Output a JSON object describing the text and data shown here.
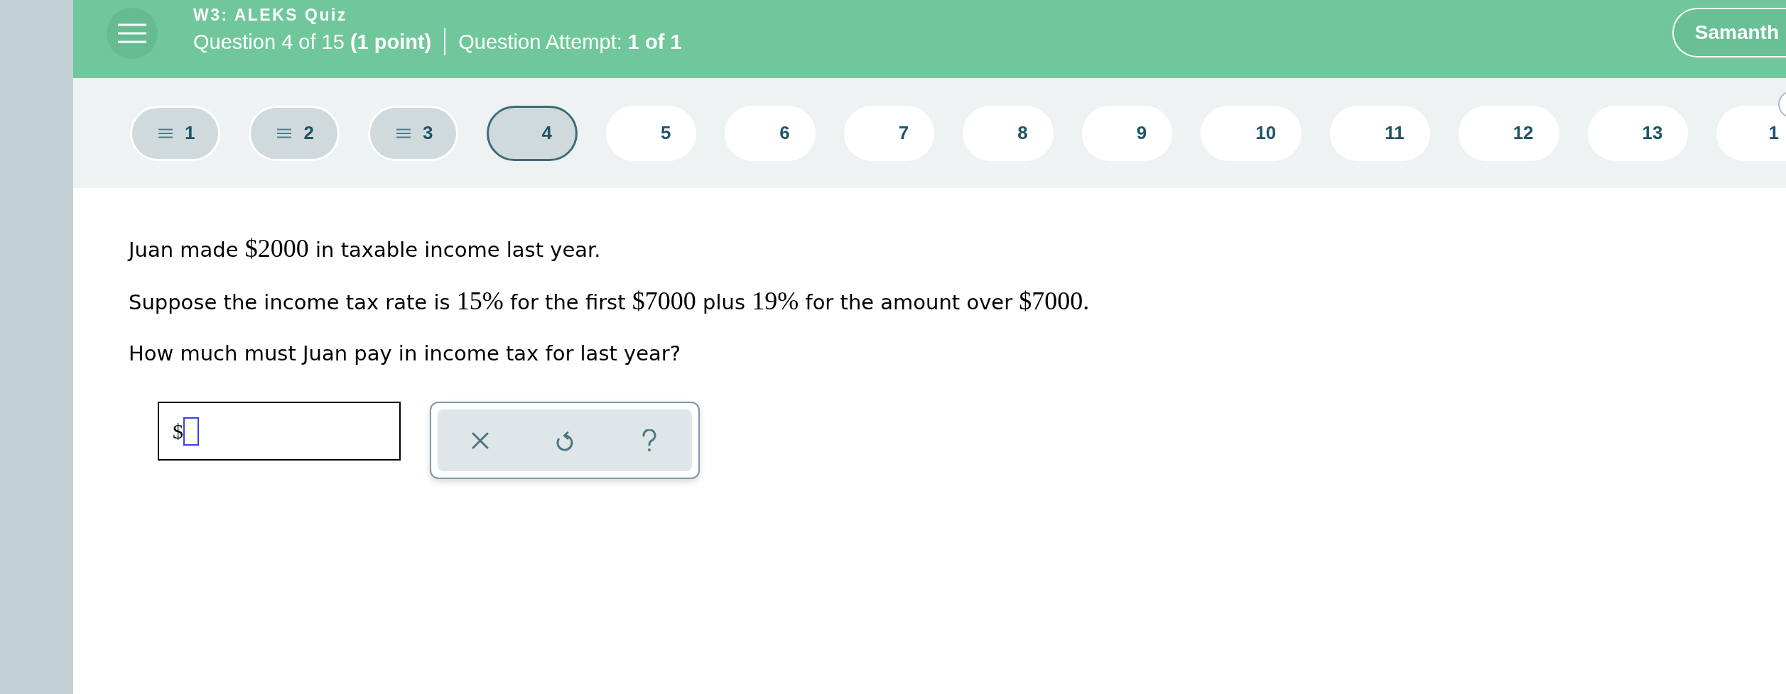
{
  "header": {
    "title": "W3: ALEKS Quiz",
    "question_info": "Question 4 of 15 **(1 point)**",
    "attempt_info": "Question Attempt: **1 of 1**",
    "user_button": "Samanth"
  },
  "question_nav": [
    {
      "label": "1",
      "answered": true,
      "selected": false
    },
    {
      "label": "2",
      "answered": true,
      "selected": false
    },
    {
      "label": "3",
      "answered": true,
      "selected": false
    },
    {
      "label": "4",
      "answered": false,
      "selected": true
    },
    {
      "label": "5",
      "answered": false,
      "selected": false
    },
    {
      "label": "6",
      "answered": false,
      "selected": false
    },
    {
      "label": "7",
      "answered": false,
      "selected": false
    },
    {
      "label": "8",
      "answered": false,
      "selected": false
    },
    {
      "label": "9",
      "answered": false,
      "selected": false
    },
    {
      "label": "10",
      "answered": false,
      "selected": false
    },
    {
      "label": "11",
      "answered": false,
      "selected": false
    },
    {
      "label": "12",
      "answered": false,
      "selected": false
    },
    {
      "label": "13",
      "answered": false,
      "selected": false
    },
    {
      "label": "1",
      "answered": false,
      "selected": false
    }
  ],
  "question": {
    "paragraphs": [
      [
        {
          "kind": "text",
          "text": "Juan made "
        },
        {
          "kind": "math",
          "text": "$2000"
        },
        {
          "kind": "text",
          "text": " in taxable income last year."
        }
      ],
      [
        {
          "kind": "text",
          "text": "Suppose the income tax rate is "
        },
        {
          "kind": "math",
          "text": "15%"
        },
        {
          "kind": "text",
          "text": " for the first "
        },
        {
          "kind": "math",
          "text": "$7000"
        },
        {
          "kind": "text",
          "text": " plus "
        },
        {
          "kind": "math",
          "text": "19%"
        },
        {
          "kind": "text",
          "text": " for the amount over "
        },
        {
          "kind": "math",
          "text": "$7000."
        }
      ],
      [
        {
          "kind": "text",
          "text": "How much must Juan pay in income tax for last year?"
        }
      ]
    ]
  },
  "answer": {
    "prefix": "$"
  }
}
